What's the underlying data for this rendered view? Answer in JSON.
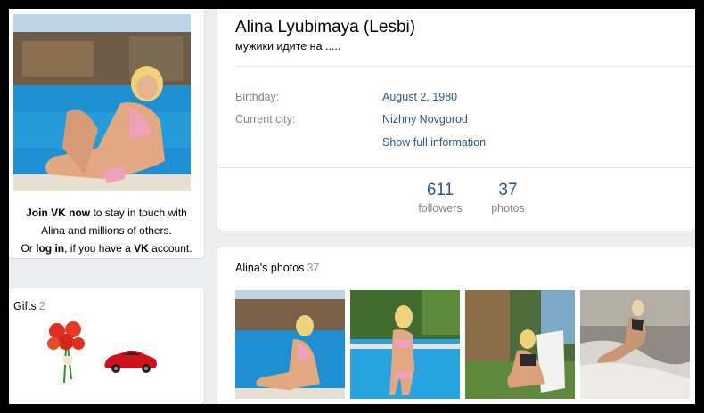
{
  "profile": {
    "name": "Alina Lyubimaya (Lesbi)",
    "status": "мужики идите на .....",
    "birthday_label": "Birthday:",
    "birthday_value": "August 2, 1980",
    "city_label": "Current city:",
    "city_value": "Nizhny Novgorod",
    "show_full": "Show full information"
  },
  "counters": [
    {
      "num": "611",
      "label": "followers"
    },
    {
      "num": "37",
      "label": "photos"
    }
  ],
  "join": {
    "line1_bold": "Join VK now",
    "line1_rest": " to stay in touch with",
    "line2": "Alina and millions of others.",
    "line3_pre": "Or ",
    "line3_login": "log in",
    "line3_mid": ", if you have a ",
    "line3_vk": "VK",
    "line3_end": " account."
  },
  "gifts": {
    "title": "Gifts",
    "count": "2"
  },
  "photos": {
    "title": "Alina's photos",
    "count": "37"
  },
  "colors": {
    "link": "#2a5885",
    "muted": "#828282",
    "bg": "#edeef0"
  }
}
